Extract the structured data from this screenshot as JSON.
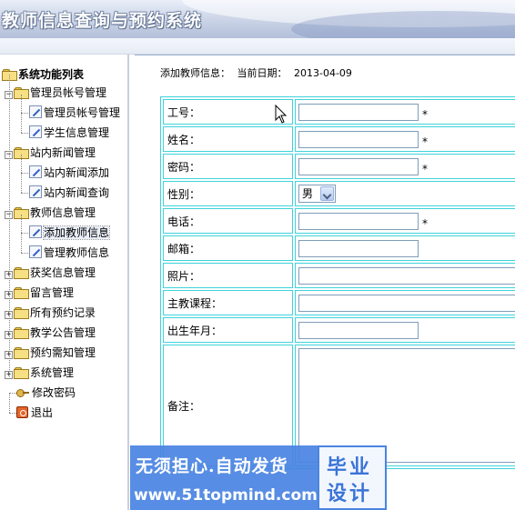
{
  "header": {
    "title": "教师信息查询与预约系统"
  },
  "sidebar": {
    "root_label": "系统功能列表",
    "groups": [
      {
        "label": "管理员帐号管理",
        "expanded": true,
        "children": [
          {
            "label": "管理员帐号管理"
          },
          {
            "label": "学生信息管理"
          }
        ]
      },
      {
        "label": "站内新闻管理",
        "expanded": true,
        "children": [
          {
            "label": "站内新闻添加"
          },
          {
            "label": "站内新闻查询"
          }
        ]
      },
      {
        "label": "教师信息管理",
        "expanded": true,
        "children": [
          {
            "label": "添加教师信息",
            "selected": true
          },
          {
            "label": "管理教师信息"
          }
        ]
      },
      {
        "label": "获奖信息管理",
        "expanded": false
      },
      {
        "label": "留言管理",
        "expanded": false
      },
      {
        "label": "所有预约记录",
        "expanded": false
      },
      {
        "label": "教学公告管理",
        "expanded": false
      },
      {
        "label": "预约需知管理",
        "expanded": false
      },
      {
        "label": "系统管理",
        "expanded": false
      }
    ],
    "extra_items": [
      {
        "label": "修改密码",
        "icon": "key-icon"
      },
      {
        "label": "退出",
        "icon": "exit-icon"
      }
    ]
  },
  "main": {
    "section_label": "添加教师信息：",
    "date_label": "当前日期：",
    "date_value": "2013-04-09",
    "form": {
      "fields": [
        {
          "label": "工号：",
          "value": "",
          "required": true
        },
        {
          "label": "姓名：",
          "value": "",
          "required": true
        },
        {
          "label": "密码：",
          "value": "",
          "required": true
        },
        {
          "label": "性别：",
          "type": "select",
          "value": "男"
        },
        {
          "label": "电话：",
          "value": "",
          "required": true
        },
        {
          "label": "邮箱：",
          "value": ""
        },
        {
          "label": "照片：",
          "value": ""
        },
        {
          "label": "主教课程：",
          "value": ""
        },
        {
          "label": "出生年月：",
          "value": ""
        },
        {
          "label": "备注：",
          "type": "textarea",
          "value": ""
        }
      ],
      "required_mark": "*"
    }
  },
  "watermark": {
    "slogan": "无须担心.自动发货",
    "site": "www.51topmind.com",
    "badge_line1": "毕业",
    "badge_line2": "设计"
  },
  "colors": {
    "table_border": "#3fd3db",
    "watermark_bg": "#4a84e2"
  }
}
